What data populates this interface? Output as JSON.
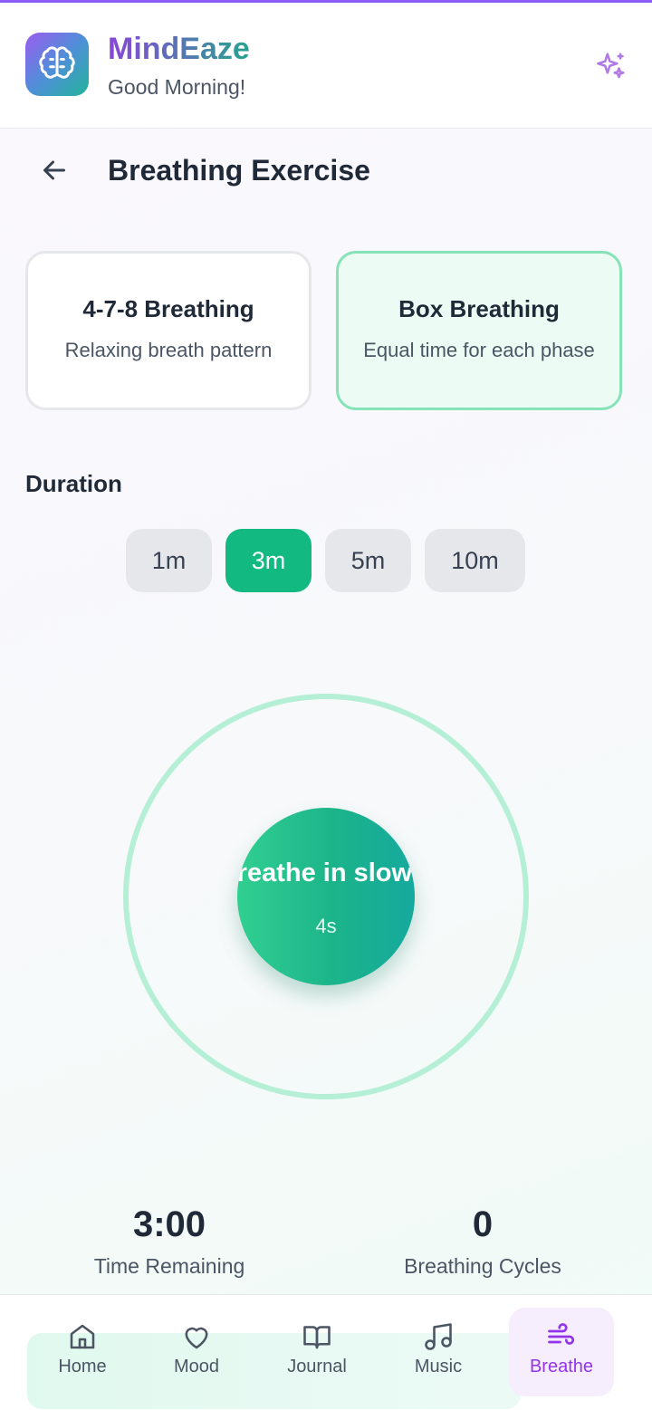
{
  "header": {
    "app_name": "MindEaze",
    "greeting": "Good Morning!",
    "logo_icon": "brain-icon",
    "action_icon": "sparkles-icon"
  },
  "page": {
    "title": "Breathing Exercise",
    "back_icon": "arrow-left-icon"
  },
  "techniques": [
    {
      "title": "4-7-8 Breathing",
      "description": "Relaxing breath pattern",
      "selected": false
    },
    {
      "title": "Box Breathing",
      "description": "Equal time for each phase",
      "selected": true
    }
  ],
  "duration": {
    "label": "Duration",
    "options": [
      "1m",
      "3m",
      "5m",
      "10m"
    ],
    "selected": "3m"
  },
  "breath_circle": {
    "instruction": "Breathe in slowly",
    "seconds": "4s"
  },
  "stats": {
    "time_remaining": {
      "value": "3:00",
      "label": "Time Remaining"
    },
    "cycles": {
      "value": "0",
      "label": "Breathing Cycles"
    }
  },
  "nav": {
    "items": [
      {
        "label": "Home",
        "icon": "home-icon",
        "active": false
      },
      {
        "label": "Mood",
        "icon": "heart-icon",
        "active": false
      },
      {
        "label": "Journal",
        "icon": "book-icon",
        "active": false
      },
      {
        "label": "Music",
        "icon": "music-icon",
        "active": false
      },
      {
        "label": "Breathe",
        "icon": "wind-icon",
        "active": true
      }
    ]
  },
  "colors": {
    "accent_green": "#12b981",
    "accent_purple": "#9333ea",
    "ring": "#b5efd6"
  }
}
